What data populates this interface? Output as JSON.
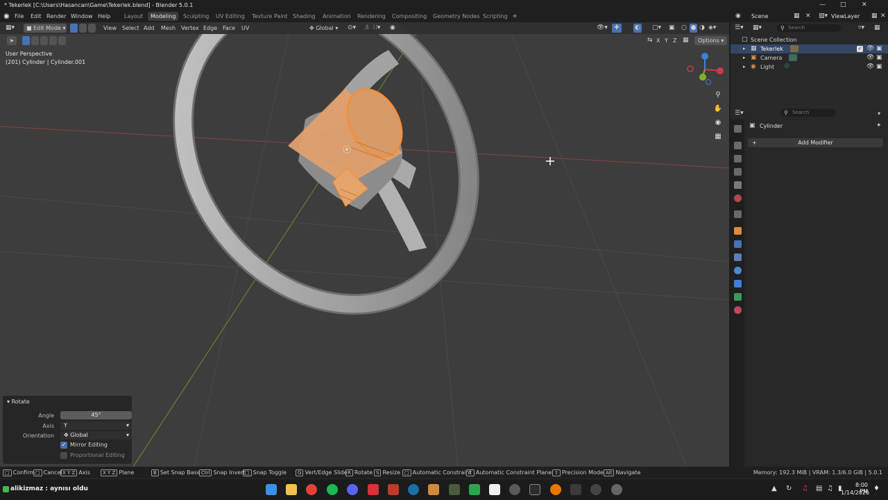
{
  "window": {
    "title": "* Tekerlek [C:\\Users\\Hasancan\\Game\\Tekerlek.blend] - Blender 5.0.1"
  },
  "menu": {
    "items": [
      "File",
      "Edit",
      "Render",
      "Window",
      "Help"
    ]
  },
  "workspaces": [
    "Layout",
    "Modeling",
    "Sculpting",
    "UV Editing",
    "Texture Paint",
    "Shading",
    "Animation",
    "Rendering",
    "Compositing",
    "Geometry Nodes",
    "Scripting",
    "+"
  ],
  "scene": {
    "label": "Scene",
    "viewlayer": "ViewLayer"
  },
  "viewport": {
    "mode": "Edit Mode",
    "menus": [
      "View",
      "Select",
      "Add",
      "Mesh",
      "Vertex",
      "Edge",
      "Face",
      "UV"
    ],
    "orientation": "Global",
    "options": "Options",
    "axes": [
      "X",
      "Y",
      "Z"
    ],
    "info_line1": "User Perspective",
    "info_line2": "(201) Cylinder | Cylinder.001"
  },
  "redo_panel": {
    "title": "Rotate",
    "angle_label": "Angle",
    "angle_value": "45°",
    "axis_label": "Axis",
    "axis_value": "Y",
    "orientation_label": "Orientation",
    "orientation_value": "Global",
    "mirror_label": "Mirror Editing",
    "proportional_label": "Proportional Editing"
  },
  "outliner": {
    "search_placeholder": "Search",
    "collection": "Scene Collection",
    "items": [
      {
        "name": "Tekerlek"
      },
      {
        "name": "Camera"
      },
      {
        "name": "Light"
      }
    ]
  },
  "properties": {
    "search_placeholder": "Search",
    "object": "Cylinder",
    "add_modifier": "Add Modifier"
  },
  "statusbar": {
    "hints": [
      {
        "keys": "",
        "label": "Confirm"
      },
      {
        "keys": "",
        "label": "Cancel"
      },
      {
        "keys": "X Y Z",
        "label": "Axis"
      },
      {
        "keys": "X Y Z",
        "label": "Plane"
      },
      {
        "keys": "B",
        "label": "Set Snap Base"
      },
      {
        "keys": "Ctrl",
        "label": "Snap Invert"
      },
      {
        "keys": "",
        "label": "Snap Toggle"
      },
      {
        "keys": "G",
        "label": "Vert/Edge Slide"
      },
      {
        "keys": "R",
        "label": "Rotate"
      },
      {
        "keys": "S",
        "label": "Resize"
      },
      {
        "keys": "",
        "label": "Automatic Constraint"
      },
      {
        "keys": "",
        "label": "Automatic Constraint Plane"
      },
      {
        "keys": "",
        "label": "Precision Mode"
      },
      {
        "keys": "Alt",
        "label": "Navigate"
      }
    ],
    "memory": "Memory: 192.3 MiB | VRAM: 1.3/6.0 GiB | 5.0.1"
  },
  "taskbar": {
    "notification": "alikizmaz : aynısı oldu",
    "time": "8:00 PM",
    "date": "1/14/2026"
  },
  "colors": {
    "accent": "#4772b3",
    "selection": "#ff8a2a",
    "x_axis": "#c93b4c",
    "y_axis": "#86b02b",
    "z_axis": "#3d7fdb"
  }
}
